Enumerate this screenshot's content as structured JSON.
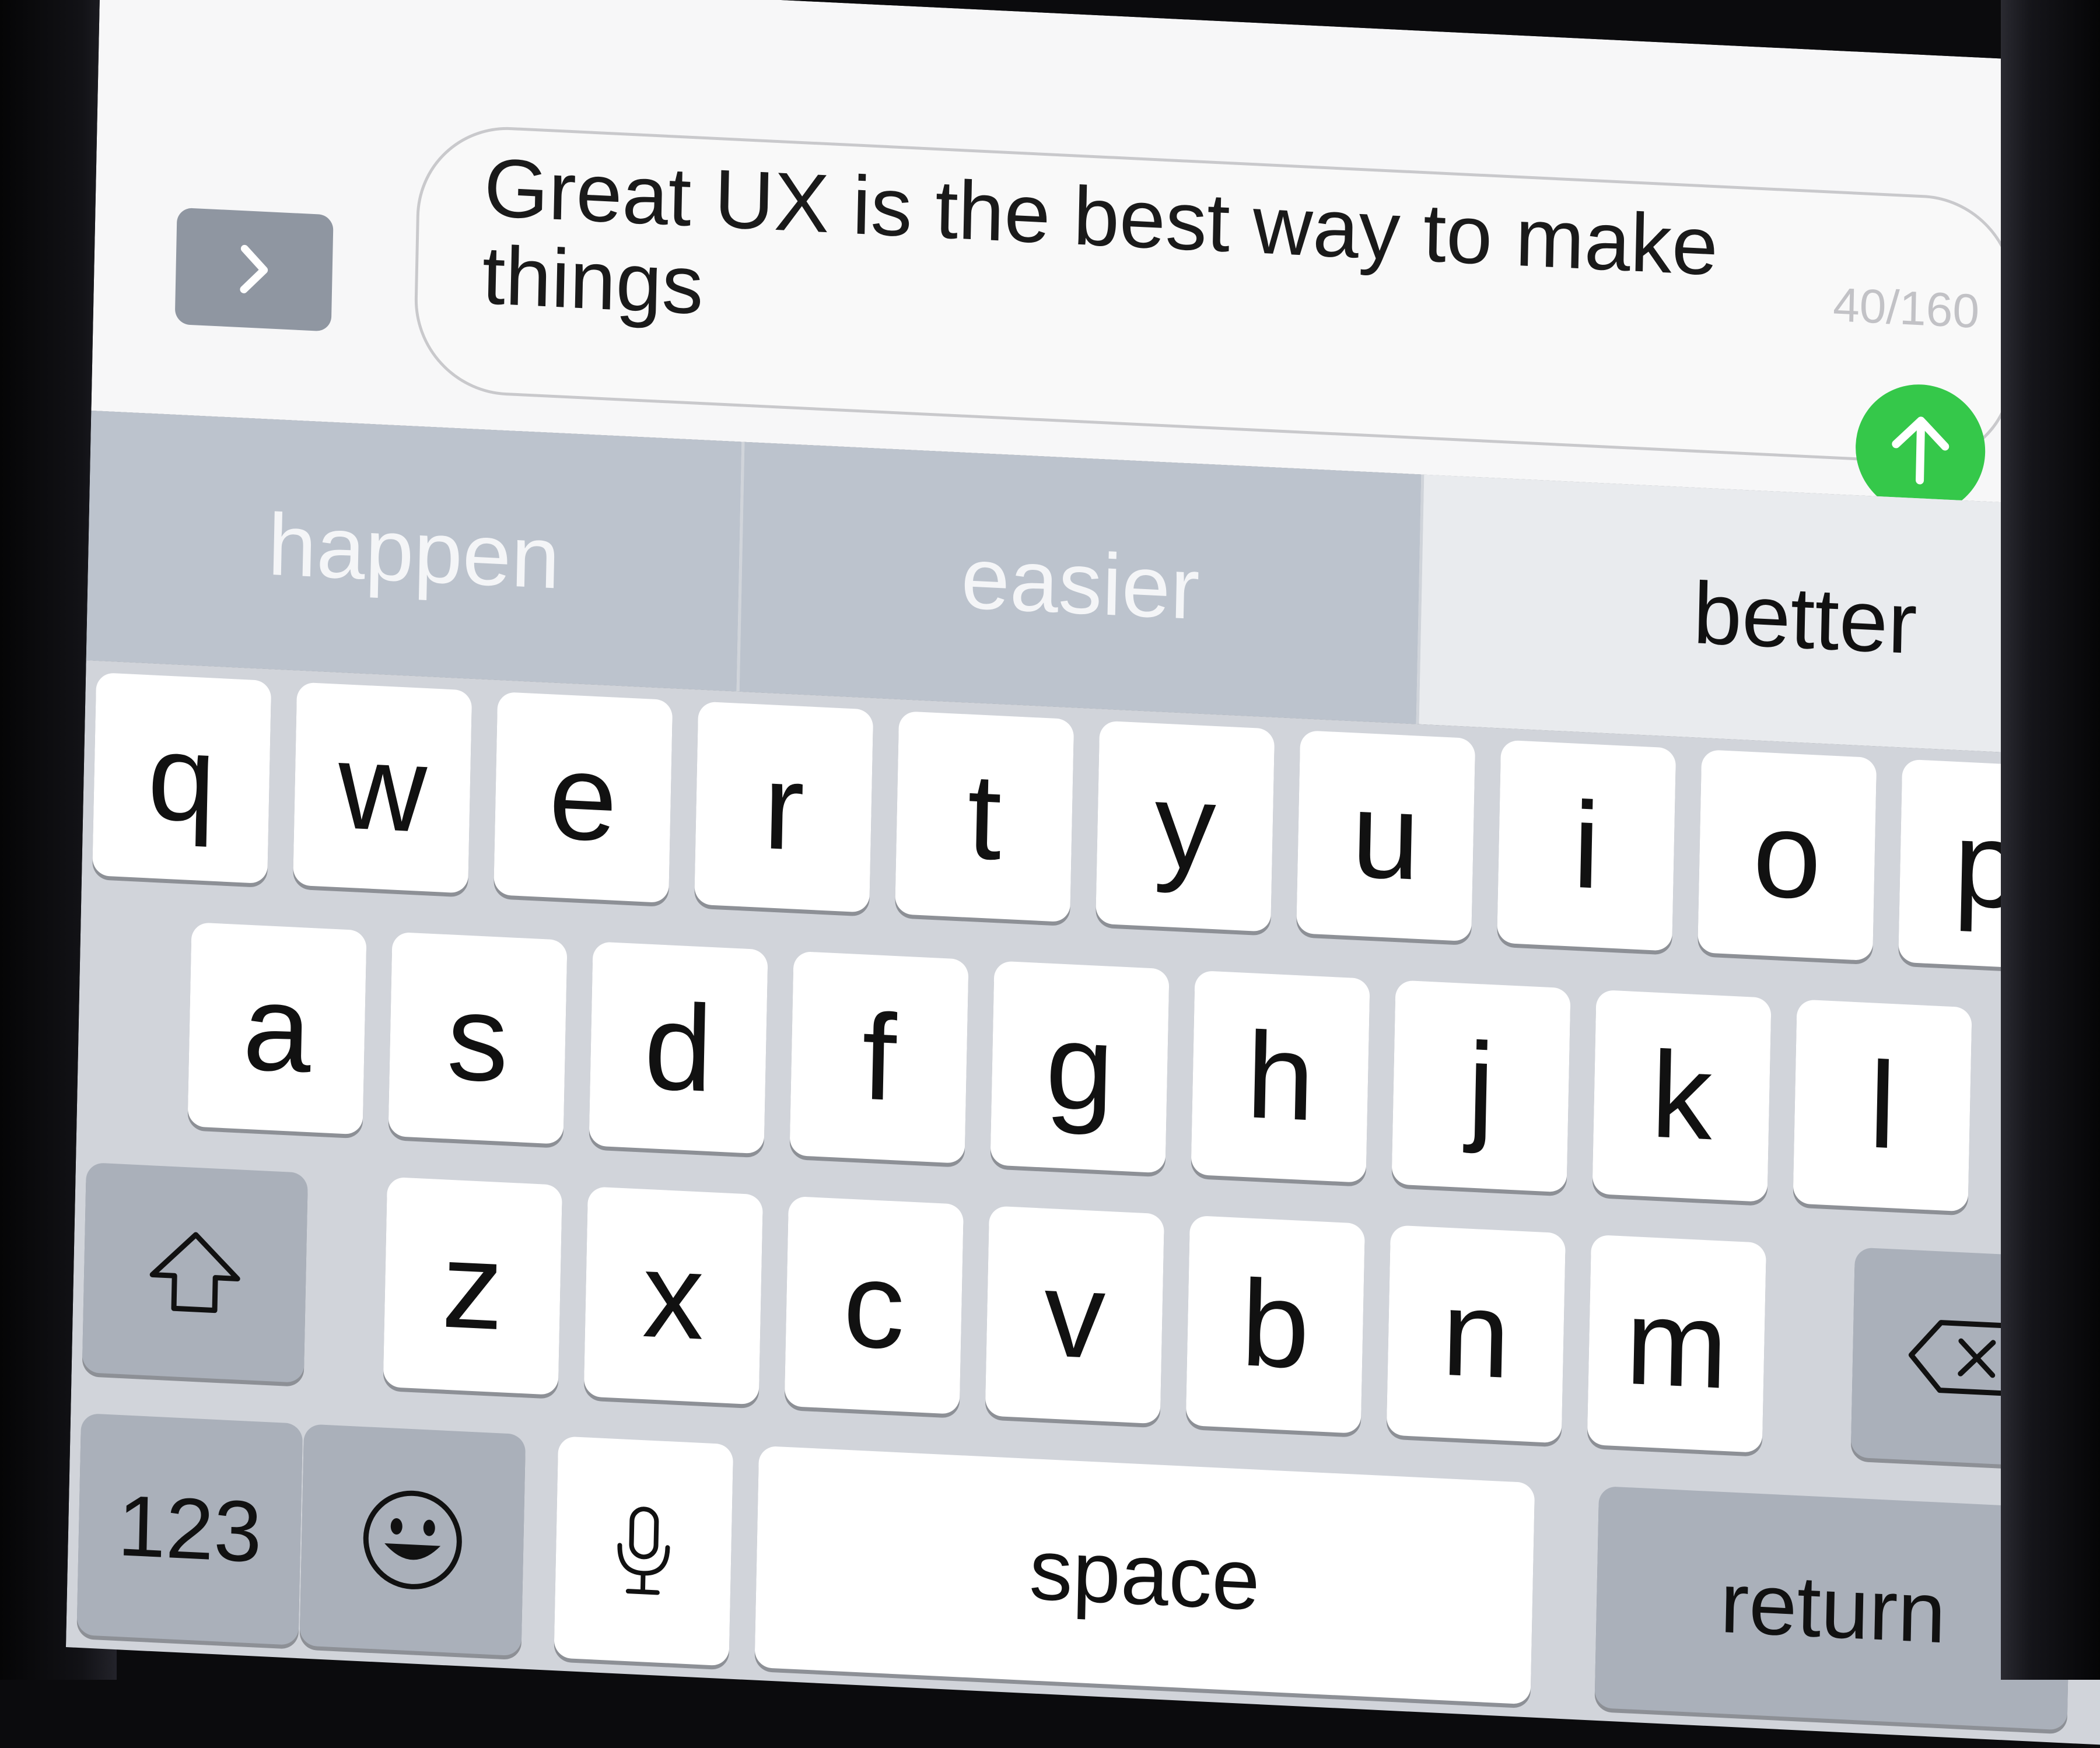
{
  "compose": {
    "message_line_1": "Great UX is the best way to make",
    "message_line_2": "things",
    "char_count": "40/160",
    "apps_button_icon": "chevron-right-icon",
    "send_button_icon": "arrow-up-icon",
    "send_color": "#35c84a"
  },
  "predictive": {
    "suggestions": [
      "happen",
      "easier",
      "better"
    ]
  },
  "keyboard": {
    "row1": [
      "q",
      "w",
      "e",
      "r",
      "t",
      "y",
      "u",
      "i",
      "o",
      "p"
    ],
    "row2": [
      "a",
      "s",
      "d",
      "f",
      "g",
      "h",
      "j",
      "k",
      "l"
    ],
    "row3": [
      "z",
      "x",
      "c",
      "v",
      "b",
      "n",
      "m"
    ],
    "shift_icon": "shift-icon",
    "backspace_icon": "backspace-icon",
    "numbers_label": "123",
    "emoji_icon": "emoji-icon",
    "mic_icon": "microphone-icon",
    "space_label": "space",
    "return_label": "return"
  }
}
